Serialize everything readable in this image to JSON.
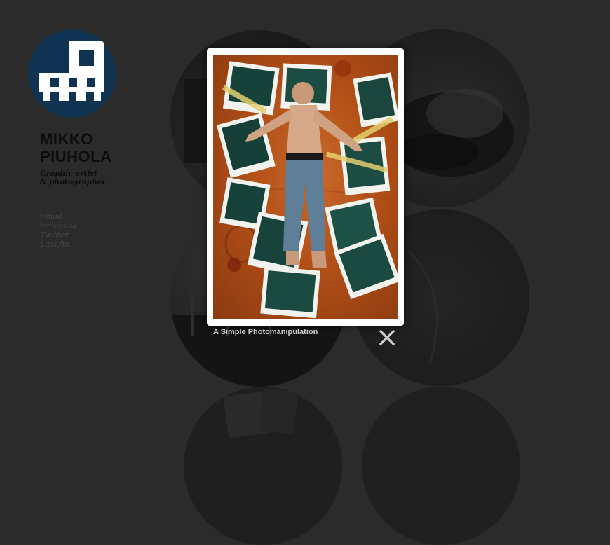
{
  "site": {
    "name_line1": "MIKKO",
    "name_line2": "PIUHOLA",
    "tagline_line1": "Graphic artist",
    "tagline_line2": "& photographer"
  },
  "links": [
    {
      "label": "Email"
    },
    {
      "label": "Facebook"
    },
    {
      "label": "Twitter"
    },
    {
      "label": "Last.fm"
    }
  ],
  "lightbox": {
    "caption": "A Simple Photomanipulation"
  },
  "icons": {
    "logo": "mp-logo-icon",
    "close": "close-icon"
  },
  "colors": {
    "background": "#2b2b2b",
    "logo": "#0f3350",
    "caption": "#d0d0d0",
    "close": "#cfcfcf"
  }
}
